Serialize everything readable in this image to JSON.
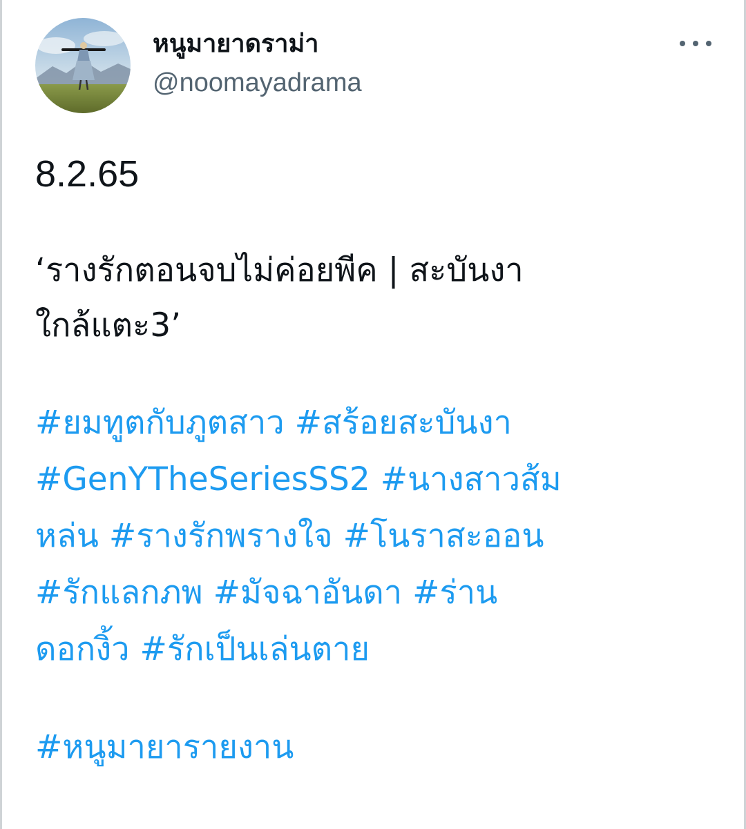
{
  "tweet": {
    "author": {
      "display_name": "หนูมายาดราม่า",
      "handle": "@noomayadrama",
      "avatar_icon": "profile-avatar-image"
    },
    "more_icon": "more-horizontal-icon",
    "text": {
      "date": "8.2.65",
      "title_line_1": "‘รางรักตอนจบไม่ค่อยพีค | สะบันงา",
      "title_line_2": "ใกล้แตะ3’"
    },
    "hashtags": [
      "#ยมทูตกับภูตสาว",
      "#สร้อยสะบันงา",
      "#GenYTheSeriesSS2",
      "#นางสาวส้ม",
      "หล่น",
      "#รางรักพรางใจ",
      "#โนราสะออน",
      "#รักแลกภพ",
      "#มัจฉาอันดา",
      "#ร่าน",
      "ดอกงิ้ว",
      "#รักเป็นเล่นตาย"
    ],
    "footer_hashtag": "#หนูมายารายงาน"
  },
  "colors": {
    "hashtag": "#1d9bf0",
    "text": "#0f1419",
    "secondary": "#536471"
  }
}
